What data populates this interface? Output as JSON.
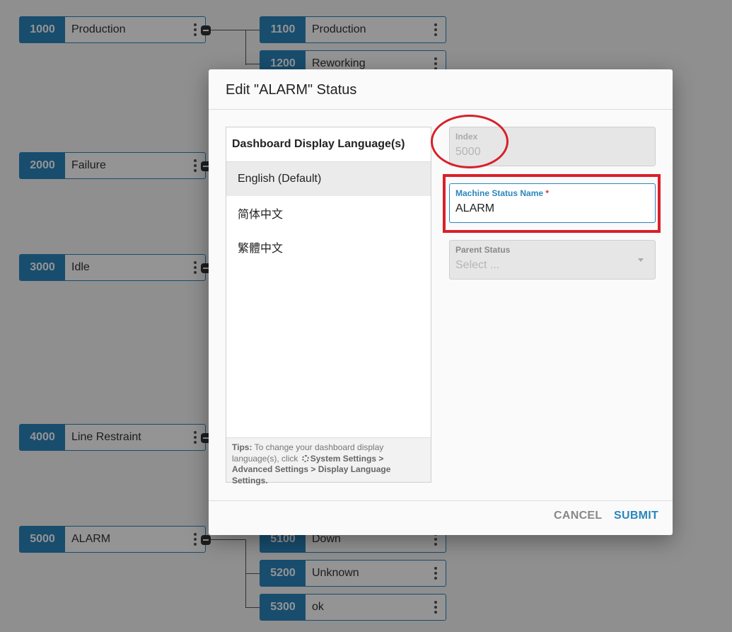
{
  "tree": {
    "parents": [
      {
        "code": "1000",
        "name": "Production"
      },
      {
        "code": "2000",
        "name": "Failure"
      },
      {
        "code": "3000",
        "name": "Idle"
      },
      {
        "code": "4000",
        "name": "Line Restraint"
      },
      {
        "code": "5000",
        "name": "ALARM"
      }
    ],
    "children": [
      {
        "code": "1100",
        "name": "Production"
      },
      {
        "code": "1200",
        "name": "Reworking"
      },
      {
        "code": "5100",
        "name": "Down"
      },
      {
        "code": "5200",
        "name": "Unknown"
      },
      {
        "code": "5300",
        "name": "ok"
      }
    ]
  },
  "dialog": {
    "title": "Edit \"ALARM\" Status",
    "language_panel": {
      "header": "Dashboard Display Language(s)",
      "items": [
        "English (Default)",
        "简体中文",
        "繁體中文"
      ],
      "selected_index": 0,
      "tips_label": "Tips:",
      "tips_text": "To change your dashboard display language(s), click",
      "tips_path": "System Settings > Advanced Settings > Display Language Settings."
    },
    "fields": {
      "index": {
        "label": "Index",
        "value": "5000",
        "disabled": true
      },
      "machine_status_name": {
        "label": "Machine Status Name",
        "required_mark": "*",
        "value": "ALARM"
      },
      "parent_status": {
        "label": "Parent Status",
        "placeholder": "Select ...",
        "disabled": true
      }
    },
    "buttons": {
      "cancel": "CANCEL",
      "submit": "SUBMIT"
    }
  },
  "colors": {
    "accent": "#2a86bd",
    "annotation": "#d8202a"
  }
}
